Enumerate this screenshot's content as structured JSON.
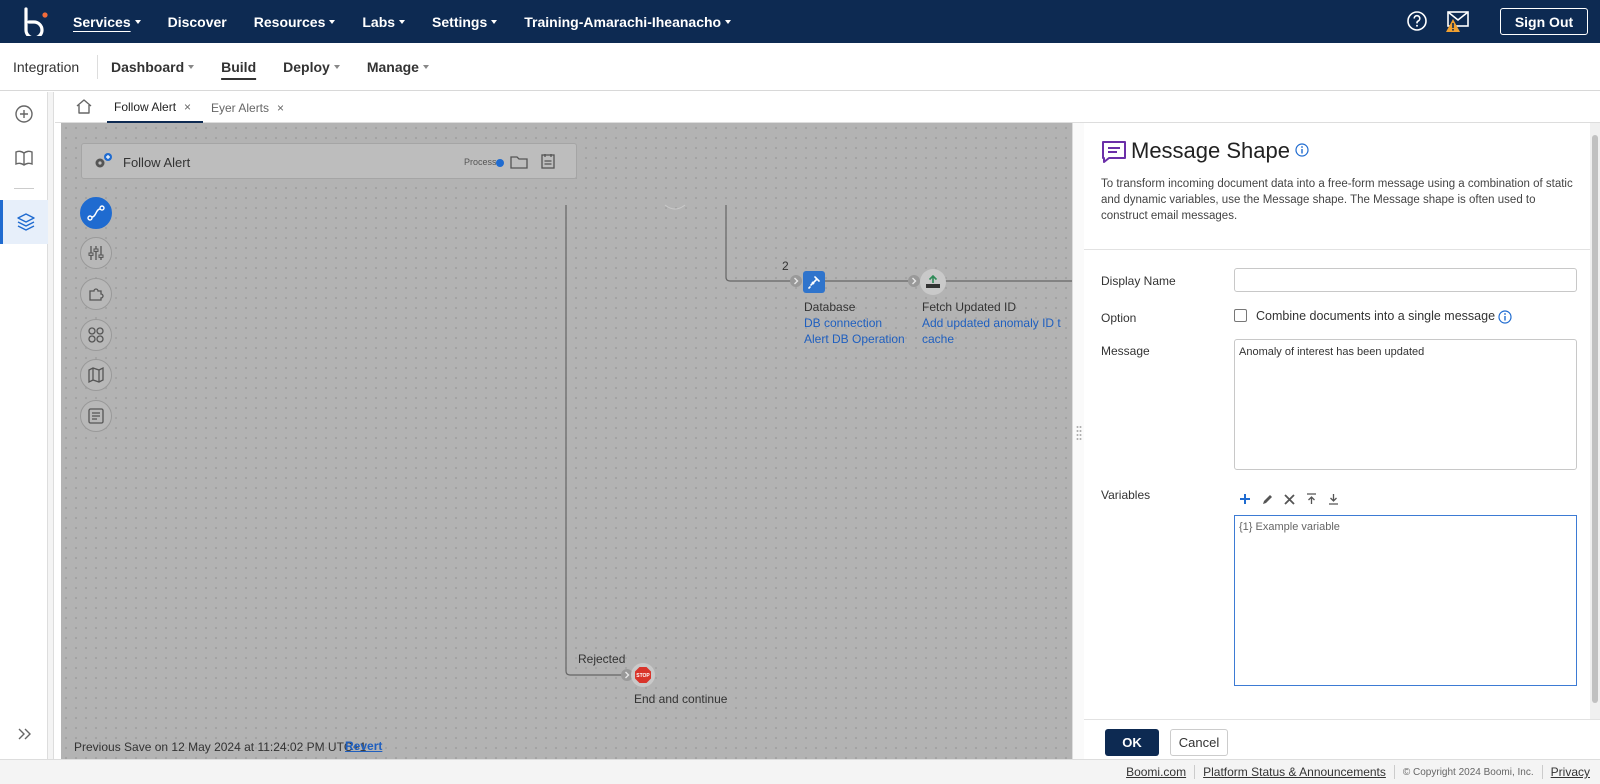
{
  "topnav": {
    "items": [
      {
        "label": "Services",
        "caret": true
      },
      {
        "label": "Discover",
        "caret": false
      },
      {
        "label": "Resources",
        "caret": true
      },
      {
        "label": "Labs",
        "caret": true
      },
      {
        "label": "Settings",
        "caret": true
      },
      {
        "label": "Training-Amarachi-Iheanacho",
        "caret": true
      }
    ],
    "sign_out": "Sign Out"
  },
  "subnav": {
    "section": "Integration",
    "items": [
      {
        "label": "Dashboard",
        "caret": true
      },
      {
        "label": "Build",
        "caret": false
      },
      {
        "label": "Deploy",
        "caret": true
      },
      {
        "label": "Manage",
        "caret": true
      }
    ]
  },
  "tabs": [
    {
      "label": "Follow Alert",
      "close": "×"
    },
    {
      "label": "Eyer Alerts",
      "close": "×"
    }
  ],
  "canvas": {
    "process_name": "Follow Alert",
    "process_label": "Process",
    "branch_number": "2",
    "database_shape": {
      "label": "Database",
      "connection": "DB connection",
      "operation": "Alert DB Operation"
    },
    "fetch_shape": {
      "label": "Fetch Updated ID",
      "link1": "Add updated anomaly ID t",
      "link2": "cache"
    },
    "rejected_label": "Rejected",
    "stop_label": "End and continue",
    "stop_text": "STOP",
    "previous_save": "Previous Save on 12 May 2024 at 11:24:02 PM UTC+1",
    "revert": "Revert"
  },
  "panel": {
    "title": "Message Shape",
    "description": "To transform incoming document data into a free-form message using a combination of static and dynamic variables, use the Message shape. The Message shape is often used to construct email messages.",
    "display_name_label": "Display Name",
    "display_name_value": "",
    "option_label": "Option",
    "combine_label": "Combine documents into a single message",
    "combine_checked": false,
    "message_label": "Message",
    "message_value": "Anomaly of interest has been updated",
    "variables_label": "Variables",
    "variables": [
      "{1} Example variable"
    ],
    "ok": "OK",
    "cancel": "Cancel"
  },
  "footer": {
    "links": [
      "Boomi.com",
      "Platform Status & Announcements"
    ],
    "copyright": "© Copyright 2024 Boomi, Inc.",
    "privacy": "Privacy"
  },
  "colors": {
    "nav_bg": "#0d2a52",
    "accent": "#1f6bd0",
    "message_icon": "#6b2fa8",
    "stop": "#d9342b",
    "warning": "#f0a030"
  }
}
